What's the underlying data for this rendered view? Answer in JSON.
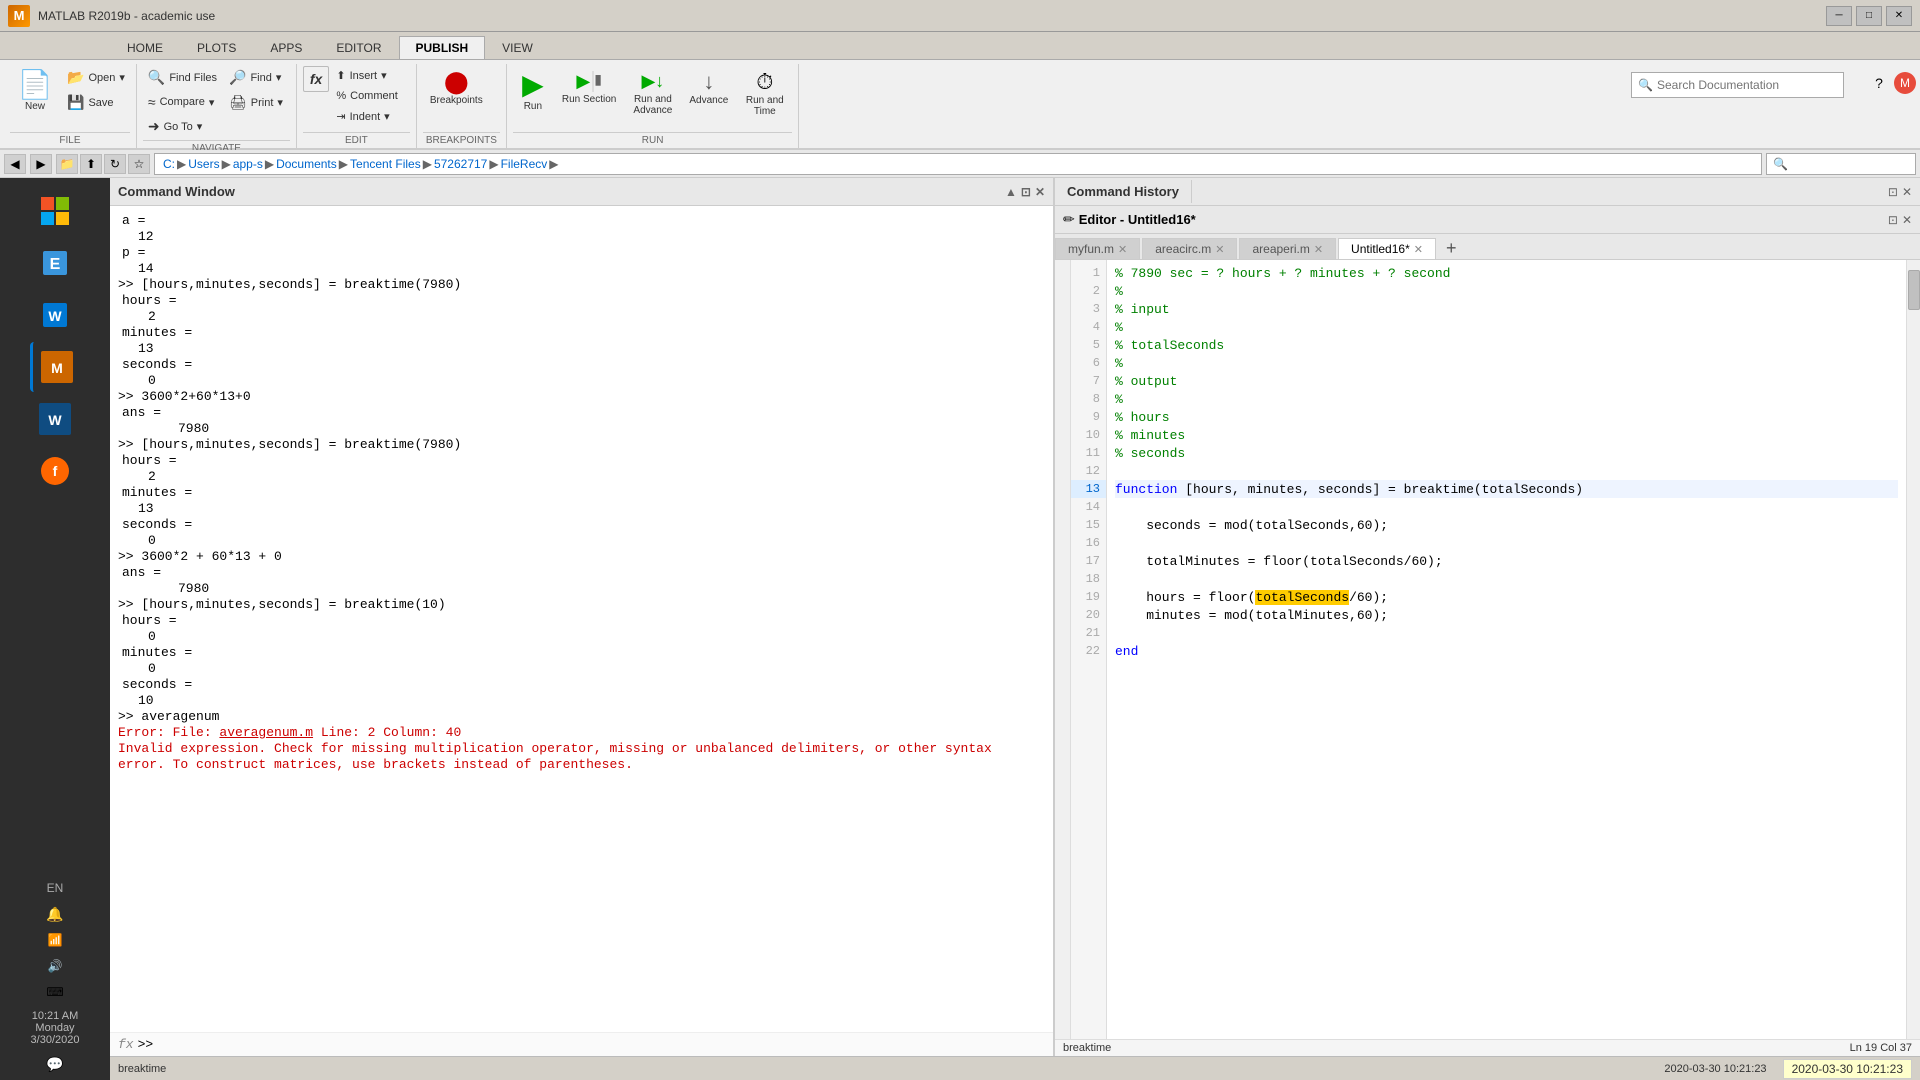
{
  "titleBar": {
    "title": "MATLAB R2019b - academic use",
    "icon": "M",
    "controls": [
      "─",
      "□",
      "✕"
    ]
  },
  "ribbonTabs": [
    "HOME",
    "PLOTS",
    "APPS",
    "EDITOR",
    "PUBLISH",
    "VIEW"
  ],
  "activeTab": "PUBLISH",
  "toolbar": {
    "file": {
      "label": "FILE",
      "buttons": [
        {
          "icon": "📄",
          "label": "New",
          "hasDropdown": true
        },
        {
          "icon": "📂",
          "label": "Open",
          "hasDropdown": true
        },
        {
          "icon": "💾",
          "label": "Save"
        }
      ]
    },
    "navigate": {
      "label": "NAVIGATE",
      "buttons": [
        {
          "icon": "🔍",
          "label": "Find Files"
        },
        {
          "icon": "≈",
          "label": "Compare",
          "hasDropdown": true
        },
        {
          "icon": "➜",
          "label": "Go To",
          "hasDropdown": true
        },
        {
          "icon": "🔎",
          "label": "Find",
          "hasDropdown": true
        },
        {
          "icon": "🖨",
          "label": "Print",
          "hasDropdown": true
        }
      ]
    },
    "edit": {
      "label": "EDIT",
      "buttons": [
        {
          "icon": "fx",
          "label": ""
        },
        {
          "icon": "⬆",
          "label": "Insert"
        },
        {
          "icon": "%%",
          "label": "Comment"
        },
        {
          "icon": "⇥",
          "label": "Indent"
        }
      ]
    },
    "breakpoints": {
      "label": "BREAKPOINTS",
      "buttons": [
        {
          "icon": "⬤",
          "label": "Breakpoints",
          "hasDropdown": true
        }
      ]
    },
    "run": {
      "label": "RUN",
      "buttons": [
        {
          "icon": "▶",
          "label": "Run"
        },
        {
          "icon": "⏭",
          "label": "Run Section"
        },
        {
          "icon": "⏩",
          "label": "Run and\nAdvance"
        },
        {
          "icon": "⏩",
          "label": "Advance"
        },
        {
          "icon": "⏱",
          "label": "Run and\nTime"
        }
      ]
    },
    "search": {
      "placeholder": "Search Documentation",
      "value": ""
    }
  },
  "navBar": {
    "path": [
      "C:",
      "Users",
      "app-s",
      "Documents",
      "Tencent Files",
      "57262717",
      "FileRecv"
    ],
    "separator": "▶"
  },
  "commandWindow": {
    "title": "Command Window",
    "lines": [
      {
        "type": "output",
        "text": "a ="
      },
      {
        "type": "output",
        "text": "    12"
      },
      {
        "type": "output",
        "text": "p ="
      },
      {
        "type": "output",
        "text": "    14"
      },
      {
        "type": "prompt",
        "text": ">> [hours,minutes,seconds] = breaktime(7980)"
      },
      {
        "type": "output",
        "text": "hours ="
      },
      {
        "type": "output",
        "text": "     2"
      },
      {
        "type": "output",
        "text": "minutes ="
      },
      {
        "type": "output",
        "text": "    13"
      },
      {
        "type": "output",
        "text": "seconds ="
      },
      {
        "type": "output",
        "text": "     0"
      },
      {
        "type": "prompt",
        "text": ">> 3600*2+60*13+0"
      },
      {
        "type": "output",
        "text": "ans ="
      },
      {
        "type": "output",
        "text": "        7980"
      },
      {
        "type": "prompt",
        "text": ">> [hours,minutes,seconds] = breaktime(7980)"
      },
      {
        "type": "output",
        "text": "hours ="
      },
      {
        "type": "output",
        "text": "     2"
      },
      {
        "type": "output",
        "text": "minutes ="
      },
      {
        "type": "output",
        "text": "    13"
      },
      {
        "type": "output",
        "text": "seconds ="
      },
      {
        "type": "output",
        "text": "     0"
      },
      {
        "type": "prompt",
        "text": ">> 3600*2 + 60*13 + 0"
      },
      {
        "type": "output",
        "text": "ans ="
      },
      {
        "type": "output",
        "text": "        7980"
      },
      {
        "type": "prompt",
        "text": ">> [hours,minutes,seconds] = breaktime(10)"
      },
      {
        "type": "output",
        "text": "hours ="
      },
      {
        "type": "output",
        "text": "     0"
      },
      {
        "type": "output",
        "text": "minutes ="
      },
      {
        "type": "output",
        "text": "     0"
      },
      {
        "type": "output",
        "text": "seconds ="
      },
      {
        "type": "output",
        "text": "    10"
      },
      {
        "type": "prompt",
        "text": ">> averagenum"
      },
      {
        "type": "error",
        "text": "Error: File: averagenum.m Line: 2 Column: 40"
      },
      {
        "type": "error",
        "text": "Invalid expression. Check for missing multiplication operator, missing or unbalanced delimiters, or other syntax"
      },
      {
        "type": "error",
        "text": "error. To construct matrices, use brackets instead of parentheses."
      }
    ],
    "inputPrompt": "fx >>"
  },
  "commandHistory": {
    "title": "Command History"
  },
  "editor": {
    "title": "Editor - Untitled16*",
    "tabs": [
      "myfun.m",
      "areacirc.m",
      "areaperi.m",
      "Untitled16*"
    ],
    "activeTab": "Untitled16*",
    "lines": [
      {
        "num": 1,
        "code": "% 7890 sec = ? hours + ? minutes + ? second",
        "type": "comment"
      },
      {
        "num": 2,
        "code": "%",
        "type": "comment"
      },
      {
        "num": 3,
        "code": "% input",
        "type": "comment"
      },
      {
        "num": 4,
        "code": "%",
        "type": "comment"
      },
      {
        "num": 5,
        "code": "% totalSeconds",
        "type": "comment"
      },
      {
        "num": 6,
        "code": "%",
        "type": "comment"
      },
      {
        "num": 7,
        "code": "% output",
        "type": "comment"
      },
      {
        "num": 8,
        "code": "%",
        "type": "comment"
      },
      {
        "num": 9,
        "code": "% hours",
        "type": "comment"
      },
      {
        "num": 10,
        "code": "% minutes",
        "type": "comment"
      },
      {
        "num": 11,
        "code": "% seconds",
        "type": "comment"
      },
      {
        "num": 12,
        "code": "",
        "type": "normal"
      },
      {
        "num": 13,
        "code": "function [hours, minutes, seconds] = breaktime(totalSeconds)",
        "type": "mixed",
        "keyword": "function"
      },
      {
        "num": 14,
        "code": "",
        "type": "normal"
      },
      {
        "num": 15,
        "code": "    seconds = mod(totalSeconds,60);",
        "type": "normal"
      },
      {
        "num": 16,
        "code": "",
        "type": "normal"
      },
      {
        "num": 17,
        "code": "    totalMinutes = floor(totalSeconds/60);",
        "type": "normal"
      },
      {
        "num": 18,
        "code": "",
        "type": "normal"
      },
      {
        "num": 19,
        "code": "    hours = floor(totalSeconds/60);",
        "type": "normal",
        "highlight": "totalSeconds"
      },
      {
        "num": 20,
        "code": "    minutes = mod(totalMinutes,60);",
        "type": "normal"
      },
      {
        "num": 21,
        "code": "",
        "type": "normal"
      },
      {
        "num": 22,
        "code": "end",
        "type": "keyword"
      }
    ]
  },
  "statusBar": {
    "left": "breaktime",
    "right": "2020-03-30  10:21:23",
    "position": "Ln 19  Col 37"
  },
  "taskbar": {
    "time": "10:21 AM",
    "day": "Monday",
    "date": "3/30/2020",
    "sysIcons": [
      "🔔",
      "⌨",
      "🔊"
    ]
  }
}
